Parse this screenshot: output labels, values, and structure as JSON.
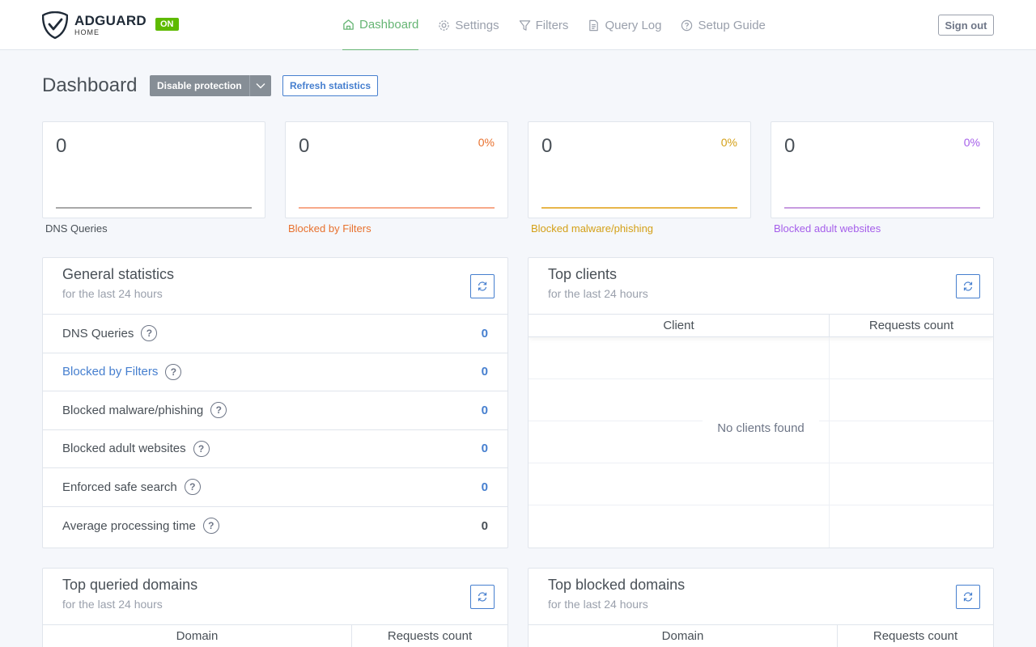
{
  "brand": {
    "name": "ADGUARD",
    "sub": "HOME",
    "status": "ON",
    "status_color": "#5eba00"
  },
  "nav": [
    {
      "label": "Dashboard",
      "icon": "home-icon",
      "active": true
    },
    {
      "label": "Settings",
      "icon": "gear-icon"
    },
    {
      "label": "Filters",
      "icon": "filter-icon"
    },
    {
      "label": "Query Log",
      "icon": "document-icon"
    },
    {
      "label": "Setup Guide",
      "icon": "help-circle-icon"
    }
  ],
  "header": {
    "signout_label": "Sign out"
  },
  "page": {
    "title": "Dashboard",
    "disable_label": "Disable protection",
    "refresh_label": "Refresh statistics"
  },
  "stats": [
    {
      "value": "0",
      "percent": "",
      "label": "DNS Queries",
      "color": "#495057",
      "line_color": "#a8a8a8"
    },
    {
      "value": "0",
      "percent": "0%",
      "label": "Blocked by Filters",
      "color": "#e8712e",
      "line_color": "#f7a98a"
    },
    {
      "value": "0",
      "percent": "0%",
      "label": "Blocked malware/phishing",
      "color": "#d4a017",
      "line_color": "#e8b64a"
    },
    {
      "value": "0",
      "percent": "0%",
      "label": "Blocked adult websites",
      "color": "#a55eea",
      "line_color": "#c79be0"
    }
  ],
  "general": {
    "title": "General statistics",
    "subtitle": "for the last 24 hours",
    "rows": [
      {
        "label": "DNS Queries",
        "value": "0"
      },
      {
        "label": "Blocked by Filters",
        "value": "0"
      },
      {
        "label": "Blocked malware/phishing",
        "value": "0"
      },
      {
        "label": "Blocked adult websites",
        "value": "0"
      },
      {
        "label": "Enforced safe search",
        "value": "0"
      },
      {
        "label": "Average processing time",
        "value": "0"
      }
    ]
  },
  "clients": {
    "title": "Top clients",
    "subtitle": "for the last 24 hours",
    "col1": "Client",
    "col2": "Requests count",
    "empty": "No clients found"
  },
  "queried": {
    "title": "Top queried domains",
    "subtitle": "for the last 24 hours",
    "col1": "Domain",
    "col2": "Requests count"
  },
  "blocked": {
    "title": "Top blocked domains",
    "subtitle": "for the last 24 hours",
    "col1": "Domain",
    "col2": "Requests count"
  }
}
